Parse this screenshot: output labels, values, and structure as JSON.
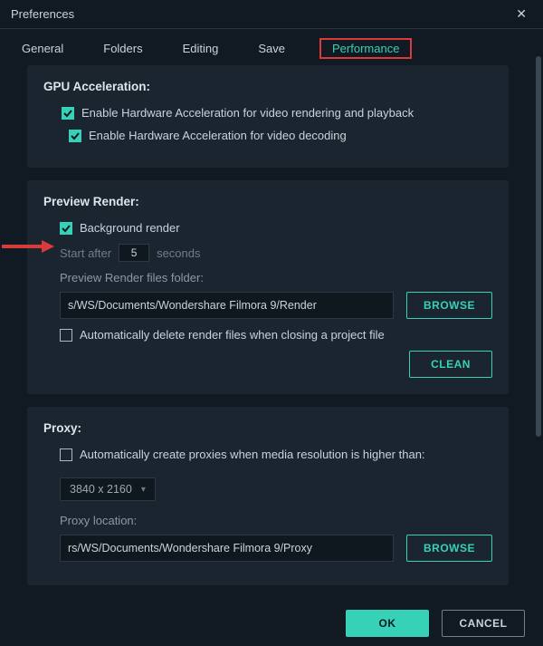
{
  "window": {
    "title": "Preferences"
  },
  "tabs": {
    "general": "General",
    "folders": "Folders",
    "editing": "Editing",
    "save": "Save",
    "performance": "Performance"
  },
  "gpu": {
    "title": "GPU Acceleration:",
    "opt1": "Enable Hardware Acceleration for video rendering and playback",
    "opt2": "Enable Hardware Acceleration for video decoding"
  },
  "preview": {
    "title": "Preview Render:",
    "bg_render": "Background render",
    "start_after": "Start after",
    "start_value": "5",
    "seconds": "seconds",
    "files_folder": "Preview Render files folder:",
    "path": "s/WS/Documents/Wondershare Filmora 9/Render",
    "browse": "BROWSE",
    "auto_delete": "Automatically delete render files when closing a project file",
    "clean": "CLEAN"
  },
  "proxy": {
    "title": "Proxy:",
    "auto_create": "Automatically create proxies when media resolution is higher than:",
    "resolution": "3840 x 2160",
    "location_label": "Proxy location:",
    "path": "rs/WS/Documents/Wondershare Filmora 9/Proxy",
    "browse": "BROWSE"
  },
  "footer": {
    "ok": "OK",
    "cancel": "CANCEL"
  }
}
